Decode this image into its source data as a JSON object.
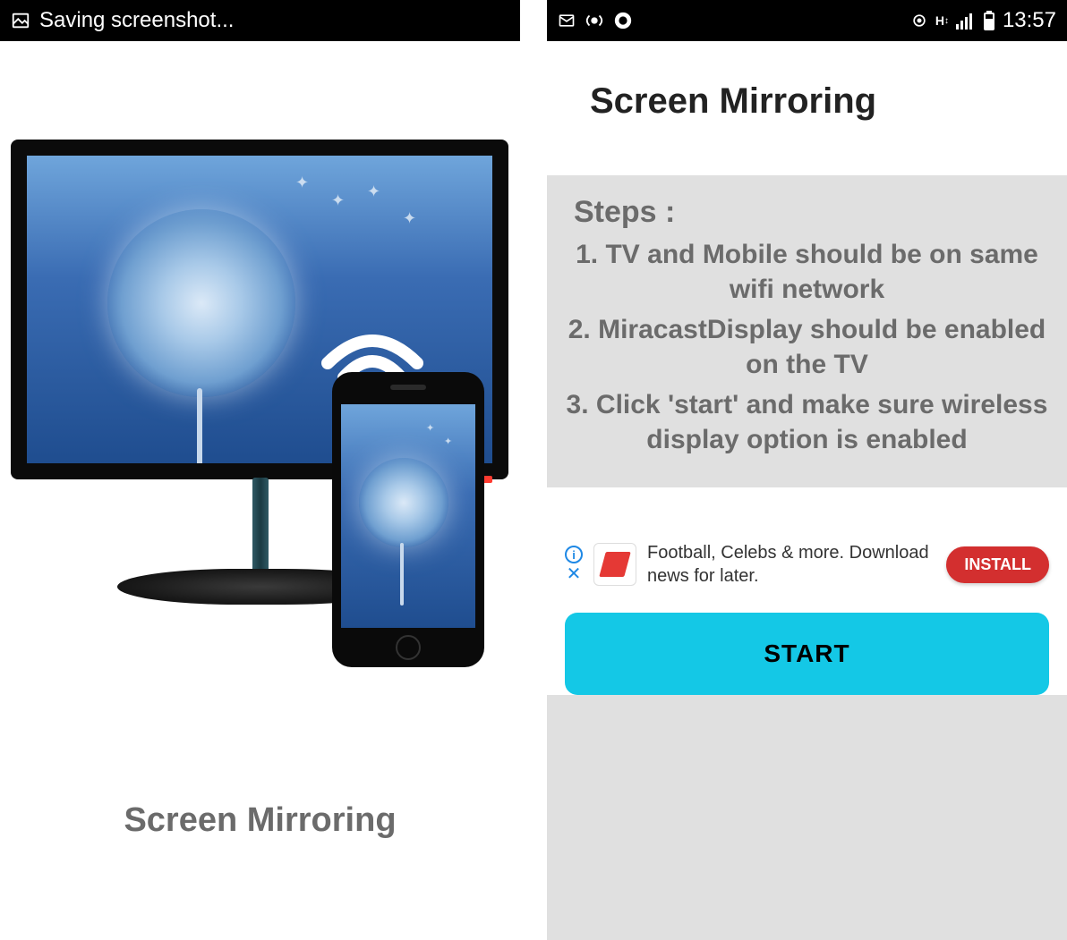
{
  "left": {
    "status_text": "Saving screenshot...",
    "title": "Screen Mirroring"
  },
  "right": {
    "status_time": "13:57",
    "title": "Screen Mirroring",
    "steps_heading": "Steps :",
    "steps": [
      "1. TV and Mobile should be on same wifi network",
      "2. MiracastDisplay should be enabled on the TV",
      "3. Click 'start' and make sure wireless display option is enabled"
    ],
    "ad": {
      "text": "Football, Celebs & more. Download news for later.",
      "install_label": "INSTALL"
    },
    "start_label": "START"
  }
}
